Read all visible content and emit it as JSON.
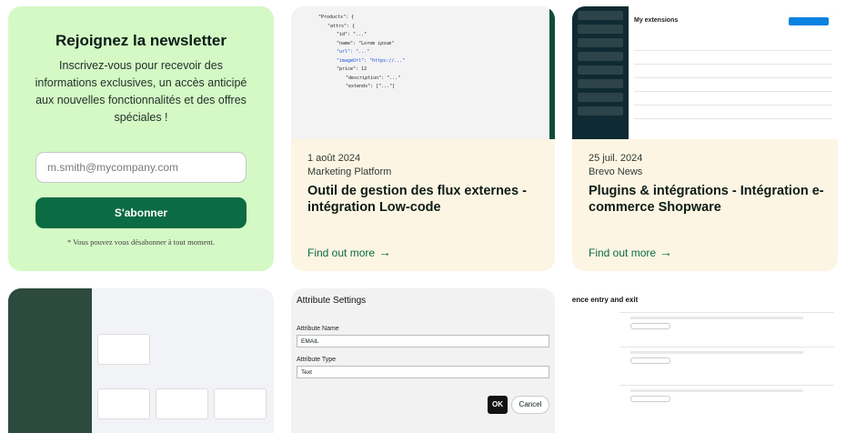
{
  "newsletter": {
    "title": "Rejoignez la newsletter",
    "text": "Inscrivez-vous pour recevoir des informations exclusives, un accès anticipé aux nouvelles fonctionnalités et des offres spéciales !",
    "email_placeholder": "m.smith@mycompany.com",
    "subscribe_label": "S'abonner",
    "note": "* Vous pouvez vous désabonner à tout moment."
  },
  "articles": [
    {
      "date": "1 août 2024",
      "category": "Marketing Platform",
      "title": "Outil de gestion des flux externes - intégration Low-code",
      "link_label": "Find out more"
    },
    {
      "date": "25 juil. 2024",
      "category": "Brevo News",
      "title": "Plugins & intégrations - Intégration e-commerce Shopware",
      "link_label": "Find out more"
    }
  ],
  "thumbs": {
    "code_lines": [
      "\"Products\": {",
      "\"attrs\": {",
      "\"id\": \"...\"",
      "\"name\": \"Lorem ipsum\"",
      "\"url\": \"...\"",
      "\"imageUrl\": \"https://...\"",
      "\"price\": 12",
      "\"description\": \"...\"",
      "\"extends\": [\"...\"]"
    ],
    "dash_title": "My extensions",
    "attr_title": "Attribute Settings",
    "attr_name_label": "Attribute Name",
    "attr_name_value": "EMAIL",
    "attr_type_label": "Attribute Type",
    "attr_type_value": "Text",
    "ok_label": "OK",
    "cancel_label": "Cancel",
    "audience_title": "Audience entry and exit"
  },
  "colors": {
    "newsletter_bg": "#d4f9c5",
    "brand_green": "#0b6b43",
    "card_bg": "#fdf5e3"
  }
}
